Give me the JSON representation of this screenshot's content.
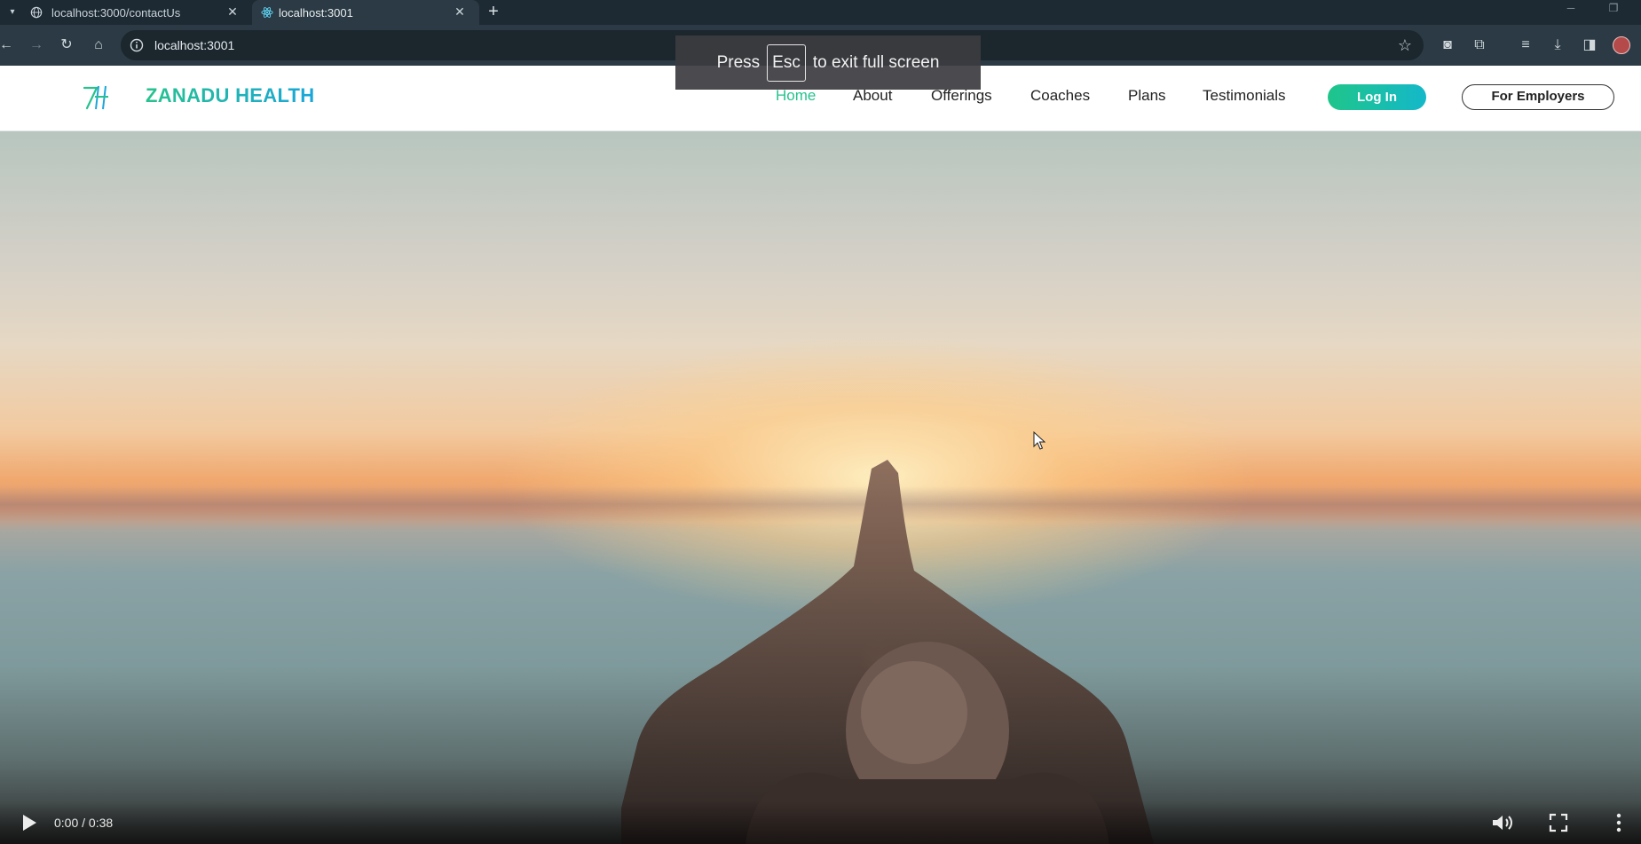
{
  "browser": {
    "tabs": [
      {
        "title": "localhost:3000/contactUs",
        "active": false,
        "icon": "globe-icon"
      },
      {
        "title": "localhost:3001",
        "active": true,
        "icon": "react-icon"
      }
    ],
    "new_tab_label": "+",
    "url": "localhost:3001"
  },
  "fullscreen_notice": {
    "prefix": "Press",
    "key": "Esc",
    "suffix": "to exit full screen"
  },
  "site": {
    "brand": "ZANADU HEALTH",
    "nav": [
      {
        "label": "Home",
        "active": true
      },
      {
        "label": "About",
        "active": false
      },
      {
        "label": "Offerings",
        "active": false
      },
      {
        "label": "Coaches",
        "active": false
      },
      {
        "label": "Plans",
        "active": false
      },
      {
        "label": "Testimonials",
        "active": false
      }
    ],
    "login_label": "Log In",
    "employers_label": "For Employers",
    "accent_color": "#27c28e",
    "accent_color_2": "#1aa6d9"
  },
  "video": {
    "time": "0:00 / 0:38",
    "progress": 0
  }
}
